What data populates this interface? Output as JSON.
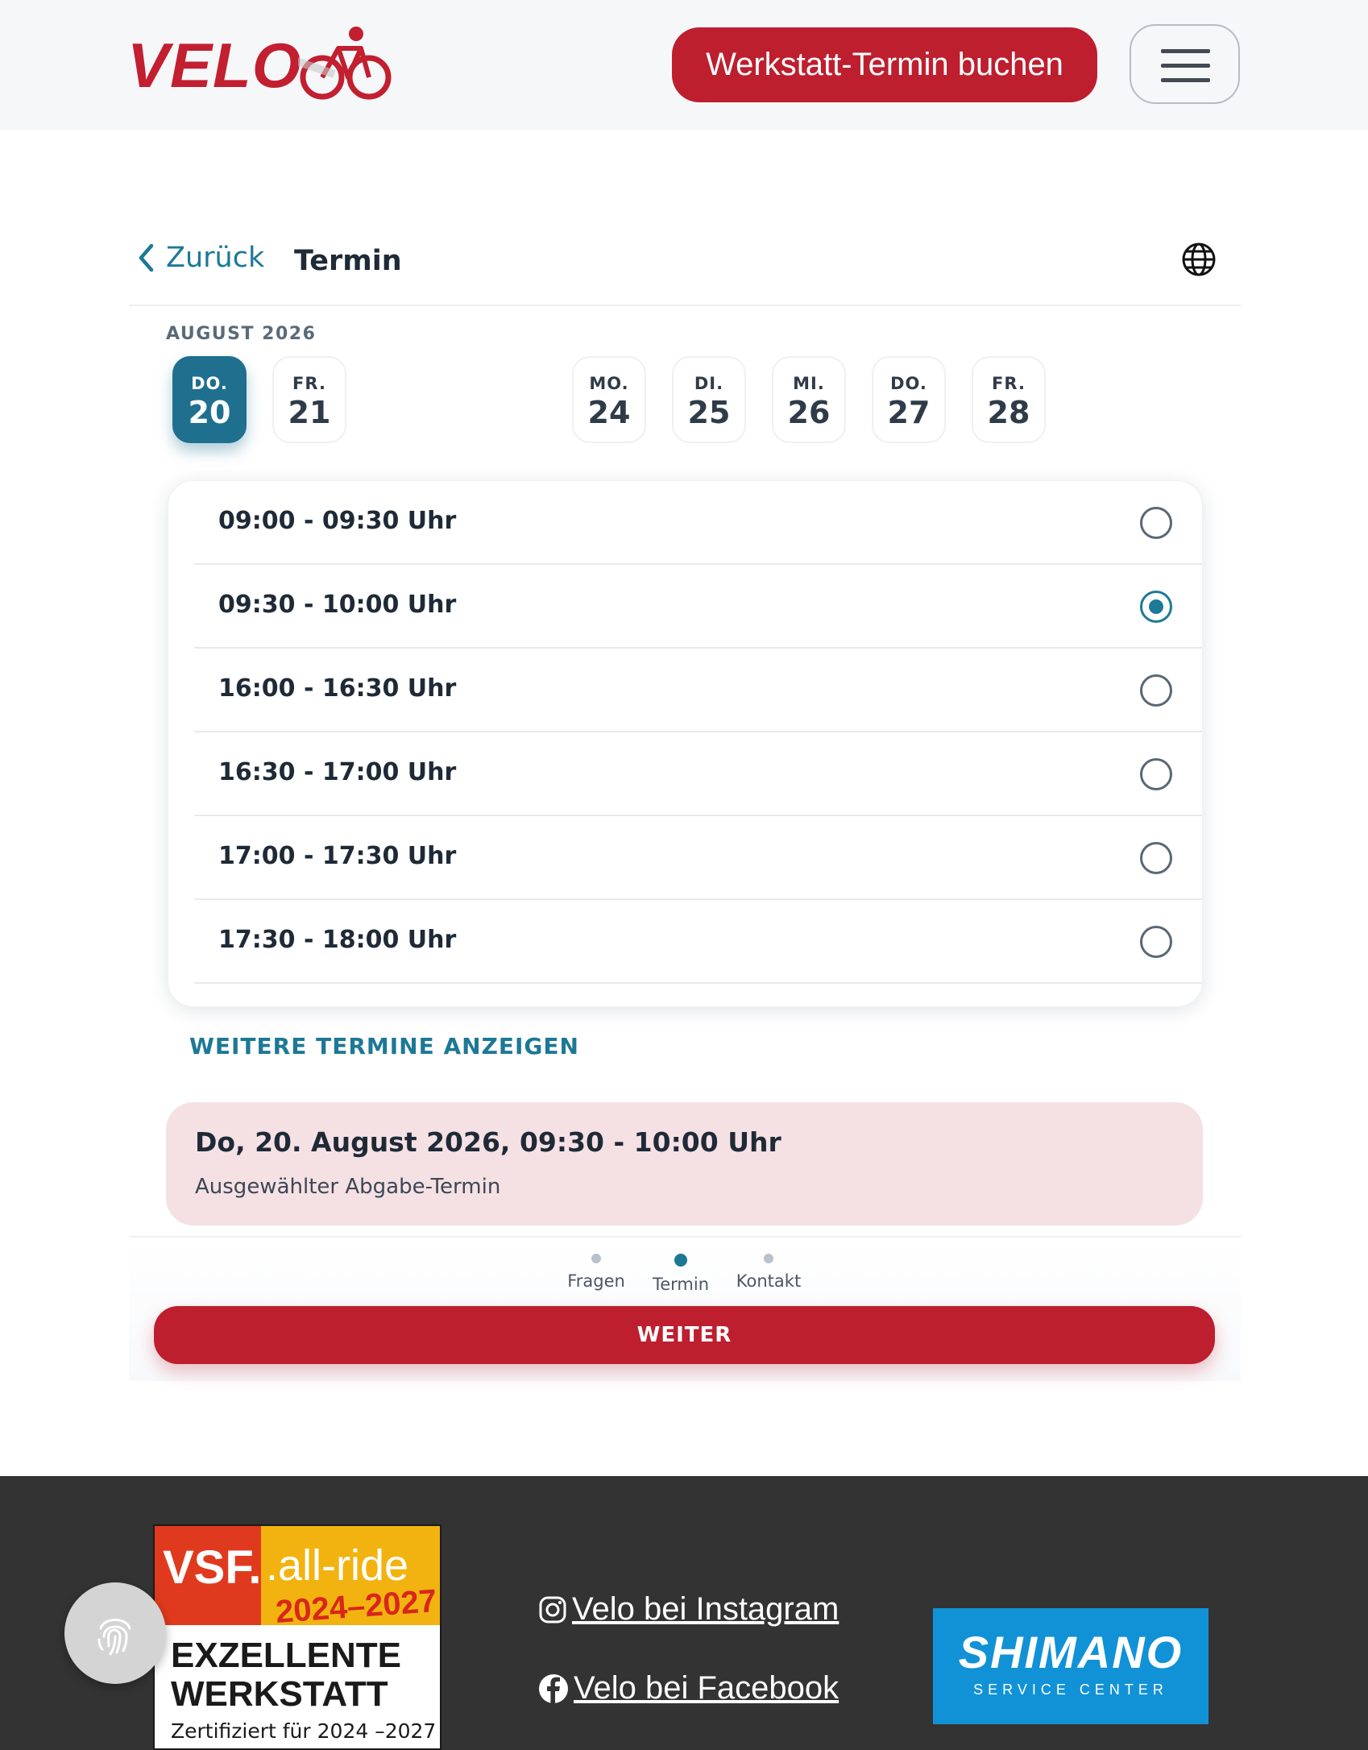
{
  "header": {
    "logo_text": "VELO",
    "book_button": "Werkstatt-Termin buchen",
    "menu_icon": "hamburger-menu-icon"
  },
  "nav": {
    "back_label": "Zurück",
    "step_title": "Termin",
    "language_icon": "globe-icon"
  },
  "calendar": {
    "month": "AUGUST 2026",
    "days": [
      {
        "weekday": "DO.",
        "date": "20",
        "selected": true
      },
      {
        "weekday": "FR.",
        "date": "21",
        "selected": false
      },
      {
        "weekday": "MO.",
        "date": "24",
        "selected": false
      },
      {
        "weekday": "DI.",
        "date": "25",
        "selected": false
      },
      {
        "weekday": "MI.",
        "date": "26",
        "selected": false
      },
      {
        "weekday": "DO.",
        "date": "27",
        "selected": false
      },
      {
        "weekday": "FR.",
        "date": "28",
        "selected": false
      }
    ]
  },
  "slots": [
    {
      "label": "09:00 - 09:30 Uhr",
      "selected": false
    },
    {
      "label": "09:30 - 10:00 Uhr",
      "selected": true
    },
    {
      "label": "16:00 - 16:30 Uhr",
      "selected": false
    },
    {
      "label": "16:30 - 17:00 Uhr",
      "selected": false
    },
    {
      "label": "17:00 - 17:30 Uhr",
      "selected": false
    },
    {
      "label": "17:30 - 18:00 Uhr",
      "selected": false
    }
  ],
  "more_label": "WEITERE TERMINE ANZEIGEN",
  "summary": {
    "title": "Do, 20. August 2026, 09:30 - 10:00 Uhr",
    "subtitle": "Ausgewählter Abgabe-Termin"
  },
  "progress": {
    "steps": [
      "Fragen",
      "Termin",
      "Kontakt"
    ],
    "current": 1
  },
  "next_button": "WEITER",
  "footer": {
    "badge": {
      "vsf": "VSF.",
      "allride": ".all-ride",
      "years": "2024–2027",
      "line1": "EXZELLENTE",
      "line2": "WERKSTATT",
      "cert": "Zertifiziert für 2024 –2027"
    },
    "instagram": "Velo bei Instagram",
    "facebook": "Velo bei Facebook",
    "shimano_title": "SHIMANO",
    "shimano_sub": "SERVICE CENTER"
  },
  "colors": {
    "brand_red": "#bd1f2f",
    "accent_teal": "#1d7896",
    "selected_day": "#1f6f8f",
    "summary_bg": "#f5e1e4",
    "footer_bg": "#333333"
  }
}
